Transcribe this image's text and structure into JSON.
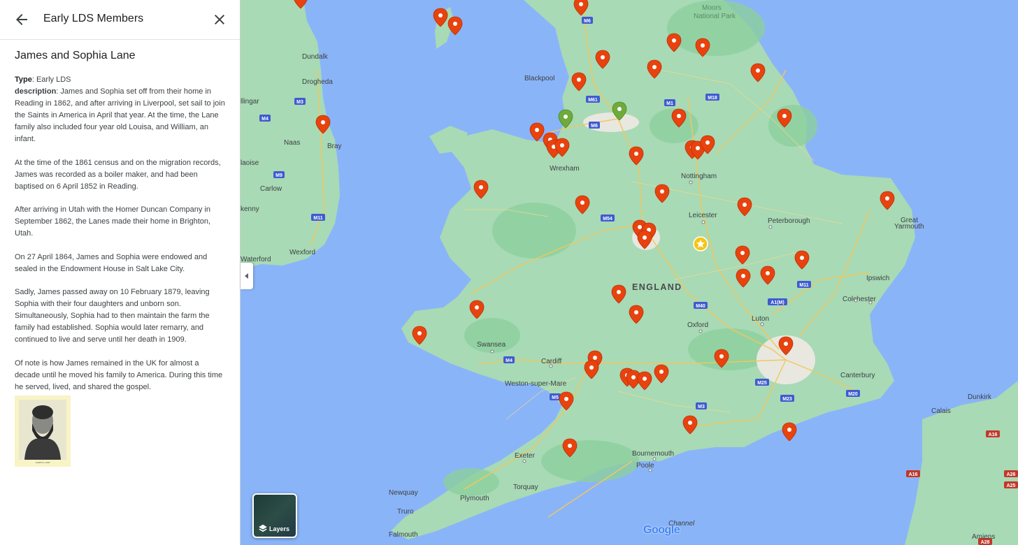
{
  "panel": {
    "back_icon": "arrow-back-icon",
    "close_icon": "close-icon",
    "title": "Early LDS Members",
    "entry": {
      "name": "James and Sophia Lane",
      "type_label": "Type",
      "type_value": ": Early LDS",
      "description_label": "description",
      "paragraphs": [
        ": James and Sophia set off from their home in Reading in 1862, and after arriving in Liverpool, set sail to join the Saints in America in April that year. At the time, the Lane family also included four year old Louisa, and William, an infant.",
        "At the time of the 1861 census and on the migration records, James was recorded as a boiler maker, and had been baptised on 6 April 1852 in Reading.",
        "After arriving in Utah with the Homer Duncan Company in September 1862, the Lanes made their home in Brighton, Utah.",
        "On 27 April 1864, James and Sophia were endowed and sealed in the Endowment House in Salt Lake City.",
        "Sadly, James passed away on 10 February 1879, leaving Sophia with their four daughters and unborn son. Simultaneously, Sophia had to then maintain the farm the family had established. Sophia would later remarry, and continued to live and serve until her death in 1909.",
        "Of note is how James remained in the UK for almost a decade until he moved his family to America. During this time he served, lived, and shared the gospel."
      ],
      "portrait_caption": "JAMES LANE"
    }
  },
  "map": {
    "country_label": "ENGLAND",
    "park_label": [
      "Moors",
      "National Park"
    ],
    "places": [
      "Dundalk",
      "Drogheda",
      "Naas",
      "Bray",
      "Carlow",
      "Wexford",
      "Waterford",
      "Blackpool",
      "Wrexham",
      "Nottingham",
      "Leicester",
      "Peterborough",
      "Great",
      "Yarmouth",
      "Ipswich",
      "Colchester",
      "Luton",
      "Oxford",
      "Swansea",
      "Cardiff",
      "Weston-super-Mare",
      "Exeter",
      "Torquay",
      "Plymouth",
      "Newquay",
      "Truro",
      "Falmouth",
      "Bournemouth",
      "Poole",
      "Canterbury",
      "Dunkirk",
      "Calais",
      "Amiens",
      "llingar",
      "laoise",
      "kenny"
    ],
    "roads": [
      "M6",
      "M61",
      "M6",
      "M1",
      "M18",
      "M3",
      "M4",
      "M9",
      "M11",
      "M54",
      "M40",
      "A1(M)",
      "M11",
      "M25",
      "M23",
      "M20",
      "M4",
      "M3",
      "M5",
      "A16",
      "A16",
      "A26",
      "A25",
      "A28"
    ],
    "channel_label": "Channel",
    "layers_label": "Layers",
    "layers_icon": "layers-icon",
    "logo": "Google",
    "colors": {
      "water": "#8ab4f8",
      "land": "#a8dab5",
      "pin_red": "#e8430e",
      "pin_green": "#6faa3c",
      "star": "#f6c514",
      "road": "#f3c65c"
    }
  }
}
